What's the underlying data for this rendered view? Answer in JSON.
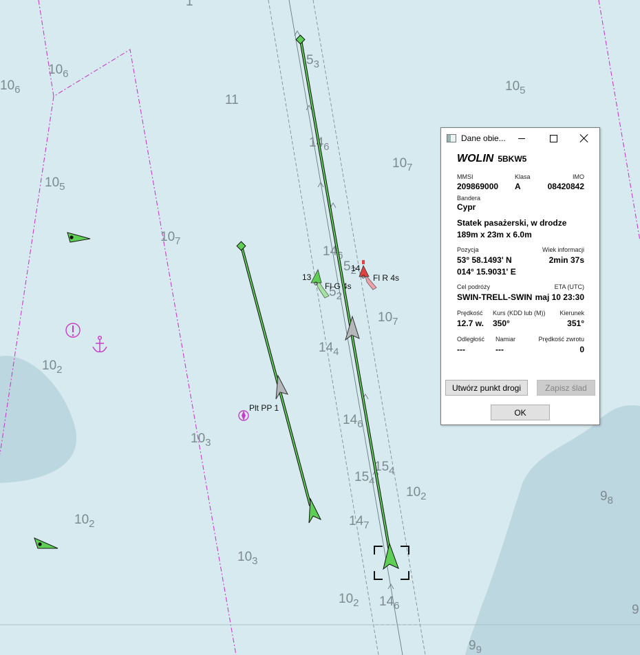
{
  "map": {
    "depths": [
      {
        "d": "1",
        "s": ""
      },
      {
        "d": "10",
        "s": "6"
      },
      {
        "d": "10",
        "s": "6"
      },
      {
        "d": "5",
        "s": "3"
      },
      {
        "d": "10",
        "s": "5"
      },
      {
        "d": "11",
        "s": ""
      },
      {
        "d": "14",
        "s": "6"
      },
      {
        "d": "10",
        "s": "7"
      },
      {
        "d": "10",
        "s": "5"
      },
      {
        "d": "10",
        "s": "7"
      },
      {
        "d": "14",
        "s": "6"
      },
      {
        "d": "5",
        "s": "2"
      },
      {
        "d": "5",
        "s": "2"
      },
      {
        "d": "10",
        "s": "7"
      },
      {
        "d": "14",
        "s": "4"
      },
      {
        "d": "10",
        "s": "2"
      },
      {
        "d": "14",
        "s": "6"
      },
      {
        "d": "10",
        "s": "3"
      },
      {
        "d": "15",
        "s": "4"
      },
      {
        "d": "15",
        "s": "4"
      },
      {
        "d": "10",
        "s": "2"
      },
      {
        "d": "9",
        "s": "8"
      },
      {
        "d": "10",
        "s": "2"
      },
      {
        "d": "14",
        "s": "7"
      },
      {
        "d": "10",
        "s": "3"
      },
      {
        "d": "10",
        "s": "2"
      },
      {
        "d": "14",
        "s": "6"
      },
      {
        "d": "9",
        "s": "9"
      },
      {
        "d": "9",
        "s": ""
      }
    ],
    "labels": {
      "light_green": "Fl G 4s",
      "light_green_no": "13",
      "light_red": "Fl R 4s",
      "light_red_no": "14",
      "pilot": "Plt PP 1"
    },
    "colors": {
      "sea": "#d6eaef",
      "deep": "#bdd7e0",
      "track": "#5fce55",
      "boundary": "#c83cc8"
    }
  },
  "dialog": {
    "title": "Dane obie...",
    "name": "WOLIN",
    "callsign": "5BKW5",
    "mmsi_label": "MMSI",
    "mmsi": "209869000",
    "class_label": "Klasa",
    "class": "A",
    "imo_label": "IMO",
    "imo": "08420842",
    "flag_label": "Bandera",
    "flag": "Cypr",
    "type": "Statek pasażerski, w drodze",
    "dims": "189m x 23m x 6.0m",
    "pos_label": "Pozycja",
    "lat": "53° 58.1493' N",
    "lon": "014° 15.9031' E",
    "age_label": "Wiek informacji",
    "age": "2min 37s",
    "dest_label": "Cel podróży",
    "dest": "SWIN-TRELL-SWIN",
    "eta_label": "ETA (UTC)",
    "eta": "maj 10 23:30",
    "sog_label": "Prędkość",
    "sog": "12.7 w.",
    "cog_label": "Kurs (KDD lub (M))",
    "cog": "350°",
    "hdg_label": "Kierunek",
    "hdg": "351°",
    "dist_label": "Odległość",
    "dist": "---",
    "brg_label": "Namiar",
    "brg": "---",
    "rot_label": "Prędkość zwrotu",
    "rot": "0",
    "btn_waypoint": "Utwórz punkt drogi",
    "btn_track": "Zapisz ślad",
    "btn_ok": "OK"
  }
}
